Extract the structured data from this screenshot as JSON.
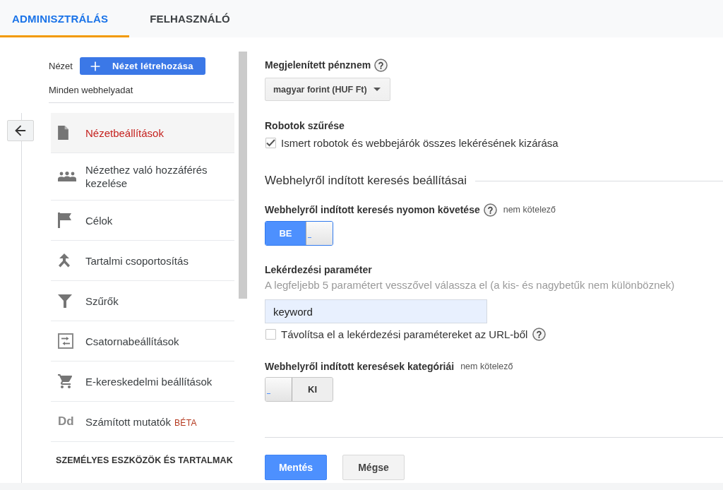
{
  "tabs": [
    {
      "label": "ADMINISZTRÁLÁS",
      "selected": true
    },
    {
      "label": "FELHASZNÁLÓ",
      "selected": false
    }
  ],
  "view_panel": {
    "label": "Nézet",
    "create_button": "Nézet létrehozása",
    "view_name": "Minden webhelyadat"
  },
  "nav_items": [
    {
      "label": "Nézetbeállítások",
      "selected": true
    },
    {
      "label": "Nézethez való hozzáférés kezelése",
      "selected": false
    },
    {
      "label": "Célok",
      "selected": false
    },
    {
      "label": "Tartalmi csoportosítás",
      "selected": false
    },
    {
      "label": "Szűrők",
      "selected": false
    },
    {
      "label": "Csatornabeállítások",
      "selected": false
    },
    {
      "label": "E-kereskedelmi beállítások",
      "selected": false
    },
    {
      "label": "Számított mutatók",
      "selected": false,
      "glyph": "Dd",
      "badge": "BÉTA"
    }
  ],
  "nav_section_heading": "SZEMÉLYES ESZKÖZÖK ÉS TARTALMAK",
  "form": {
    "currency": {
      "label": "Megjelenített pénznem",
      "help": true,
      "value": "magyar forint (HUF Ft)"
    },
    "bot_filtering": {
      "label": "Robotok szűrése",
      "checkbox": {
        "label": "Ismert robotok és webbejárók összes lekérésének kizárása",
        "checked": true
      }
    },
    "section_title": "Webhelyről indított keresés beállításai",
    "site_search_tracking": {
      "label": "Webhelyről indított keresés nyomon követése",
      "help": true,
      "note": "nem kötelező",
      "toggle": {
        "on": true,
        "label": "BE"
      }
    },
    "query_parameter": {
      "label": "Lekérdezési paraméter",
      "hint": "A legfeljebb 5 paramétert vesszővel válassza el (a kis- és nagybetűk nem különböznek)",
      "value": "keyword",
      "checkbox": {
        "label": "Távolítsa el a lekérdezési paramétereket az URL-ből",
        "checked": false,
        "help": true
      }
    },
    "site_search_categories": {
      "label": "Webhelyről indított keresések kategóriái",
      "note": "nem kötelező",
      "toggle": {
        "on": false,
        "label": "KI"
      }
    }
  },
  "buttons": [
    {
      "label": "Mentés",
      "kind": "primary"
    },
    {
      "label": "Mégse",
      "kind": "secondary"
    }
  ]
}
